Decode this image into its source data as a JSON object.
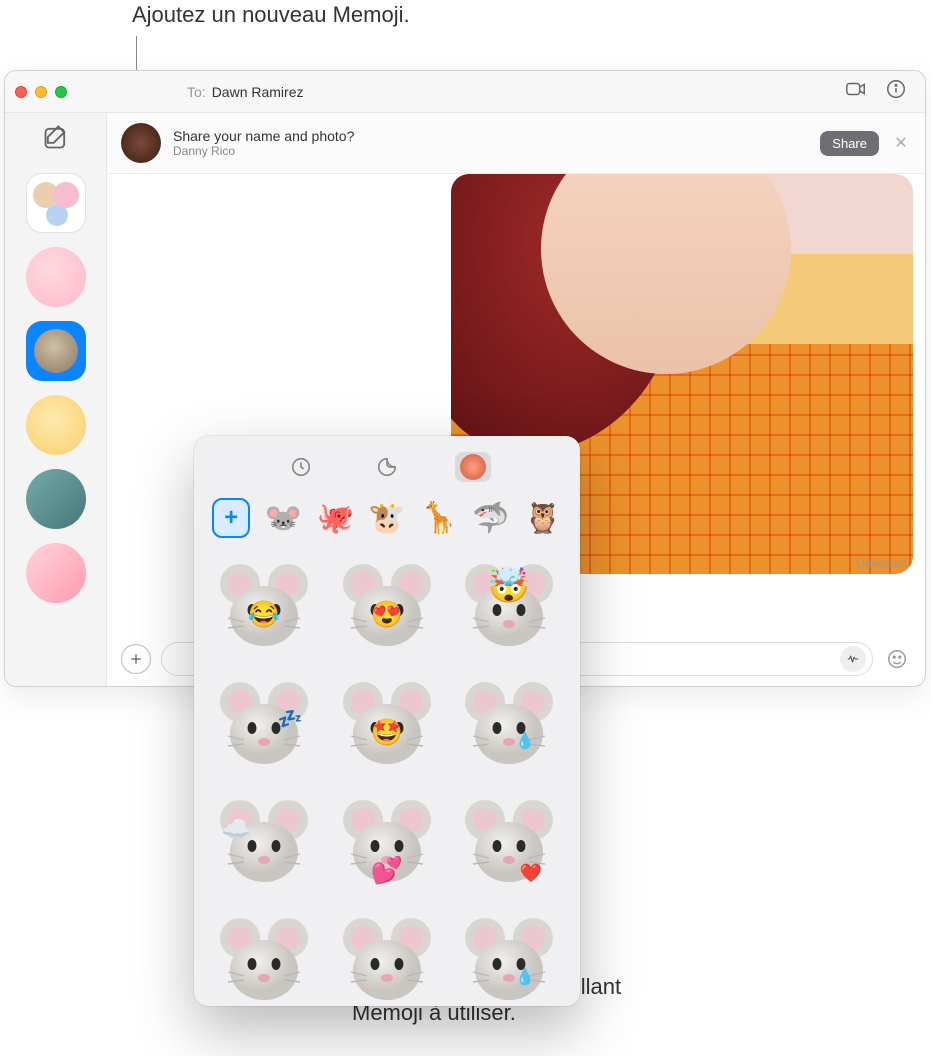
{
  "callouts": {
    "top": "Ajoutez un nouveau Memoji.",
    "bottom_l1": "Sélectionnez un autocollant",
    "bottom_l2": "Memoji à utiliser."
  },
  "header": {
    "to_label": "To:",
    "recipient": "Dawn Ramirez"
  },
  "banner": {
    "title": "Share your name and photo?",
    "subtitle": "Danny Rico",
    "share_label": "Share"
  },
  "message": {
    "delivered_label": "Delivered"
  },
  "popover": {
    "add_label": "+",
    "character_row": [
      {
        "name": "mouse",
        "glyph": "🐭"
      },
      {
        "name": "octopus",
        "glyph": "🐙"
      },
      {
        "name": "cow",
        "glyph": "🐮"
      },
      {
        "name": "giraffe",
        "glyph": "🦒"
      },
      {
        "name": "shark",
        "glyph": "🦈"
      },
      {
        "name": "owl",
        "glyph": "🦉"
      }
    ],
    "stickers": [
      {
        "id": "mouse-laugh-cry",
        "overlay": "😂"
      },
      {
        "id": "mouse-heart-eyes",
        "overlay": "😍"
      },
      {
        "id": "mouse-mind-blown",
        "overlay": "🤯"
      },
      {
        "id": "mouse-sleeping",
        "overlay": "💤"
      },
      {
        "id": "mouse-star-eyes",
        "overlay": "🤩"
      },
      {
        "id": "mouse-tear",
        "overlay": "💧"
      },
      {
        "id": "mouse-cloud",
        "overlay": "☁️"
      },
      {
        "id": "mouse-kiss-hearts",
        "overlay": "💕"
      },
      {
        "id": "mouse-shy-heart",
        "overlay": "❤️"
      },
      {
        "id": "mouse-worried",
        "overlay": ""
      },
      {
        "id": "mouse-angry",
        "overlay": ""
      },
      {
        "id": "mouse-sweat",
        "overlay": "💧"
      }
    ]
  }
}
